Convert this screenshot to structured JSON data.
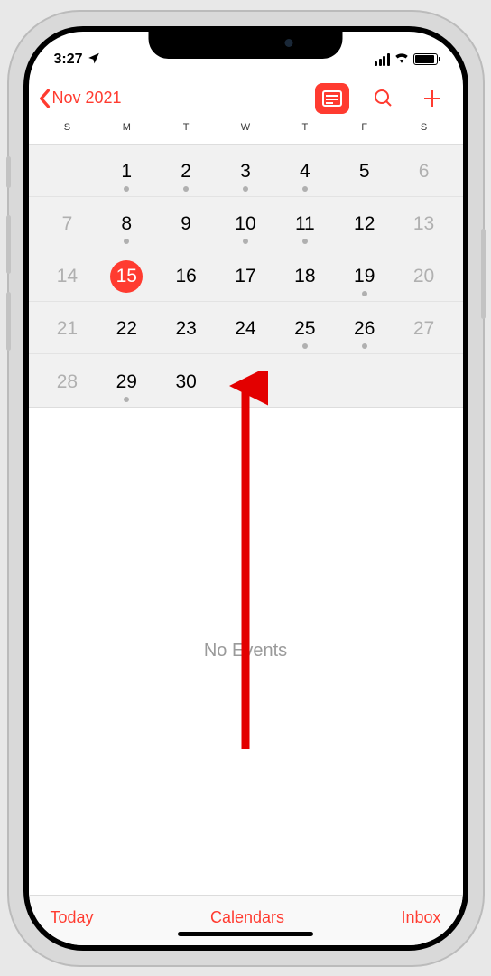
{
  "statusBar": {
    "time": "3:27",
    "locationIcon": "location-arrow"
  },
  "navHeader": {
    "backLabel": "Nov 2021"
  },
  "weekdays": [
    "S",
    "M",
    "T",
    "W",
    "T",
    "F",
    "S"
  ],
  "calendar": {
    "weeks": [
      [
        {
          "n": "",
          "dim": false,
          "dot": false,
          "selected": false
        },
        {
          "n": "1",
          "dim": false,
          "dot": true,
          "selected": false
        },
        {
          "n": "2",
          "dim": false,
          "dot": true,
          "selected": false
        },
        {
          "n": "3",
          "dim": false,
          "dot": true,
          "selected": false
        },
        {
          "n": "4",
          "dim": false,
          "dot": true,
          "selected": false
        },
        {
          "n": "5",
          "dim": false,
          "dot": false,
          "selected": false
        },
        {
          "n": "6",
          "dim": true,
          "dot": false,
          "selected": false
        }
      ],
      [
        {
          "n": "7",
          "dim": true,
          "dot": false,
          "selected": false
        },
        {
          "n": "8",
          "dim": false,
          "dot": true,
          "selected": false
        },
        {
          "n": "9",
          "dim": false,
          "dot": false,
          "selected": false
        },
        {
          "n": "10",
          "dim": false,
          "dot": true,
          "selected": false
        },
        {
          "n": "11",
          "dim": false,
          "dot": true,
          "selected": false
        },
        {
          "n": "12",
          "dim": false,
          "dot": false,
          "selected": false
        },
        {
          "n": "13",
          "dim": true,
          "dot": false,
          "selected": false
        }
      ],
      [
        {
          "n": "14",
          "dim": true,
          "dot": false,
          "selected": false
        },
        {
          "n": "15",
          "dim": false,
          "dot": false,
          "selected": true
        },
        {
          "n": "16",
          "dim": false,
          "dot": false,
          "selected": false
        },
        {
          "n": "17",
          "dim": false,
          "dot": false,
          "selected": false
        },
        {
          "n": "18",
          "dim": false,
          "dot": false,
          "selected": false
        },
        {
          "n": "19",
          "dim": false,
          "dot": true,
          "selected": false
        },
        {
          "n": "20",
          "dim": true,
          "dot": false,
          "selected": false
        }
      ],
      [
        {
          "n": "21",
          "dim": true,
          "dot": false,
          "selected": false
        },
        {
          "n": "22",
          "dim": false,
          "dot": false,
          "selected": false
        },
        {
          "n": "23",
          "dim": false,
          "dot": false,
          "selected": false
        },
        {
          "n": "24",
          "dim": false,
          "dot": false,
          "selected": false
        },
        {
          "n": "25",
          "dim": false,
          "dot": true,
          "selected": false
        },
        {
          "n": "26",
          "dim": false,
          "dot": true,
          "selected": false
        },
        {
          "n": "27",
          "dim": true,
          "dot": false,
          "selected": false
        }
      ],
      [
        {
          "n": "28",
          "dim": true,
          "dot": false,
          "selected": false
        },
        {
          "n": "29",
          "dim": false,
          "dot": true,
          "selected": false
        },
        {
          "n": "30",
          "dim": false,
          "dot": false,
          "selected": false
        },
        {
          "n": "",
          "dim": false,
          "dot": false,
          "selected": false
        },
        {
          "n": "",
          "dim": false,
          "dot": false,
          "selected": false
        },
        {
          "n": "",
          "dim": false,
          "dot": false,
          "selected": false
        },
        {
          "n": "",
          "dim": false,
          "dot": false,
          "selected": false
        }
      ]
    ]
  },
  "events": {
    "emptyLabel": "No Events"
  },
  "toolbar": {
    "today": "Today",
    "calendars": "Calendars",
    "inbox": "Inbox"
  }
}
